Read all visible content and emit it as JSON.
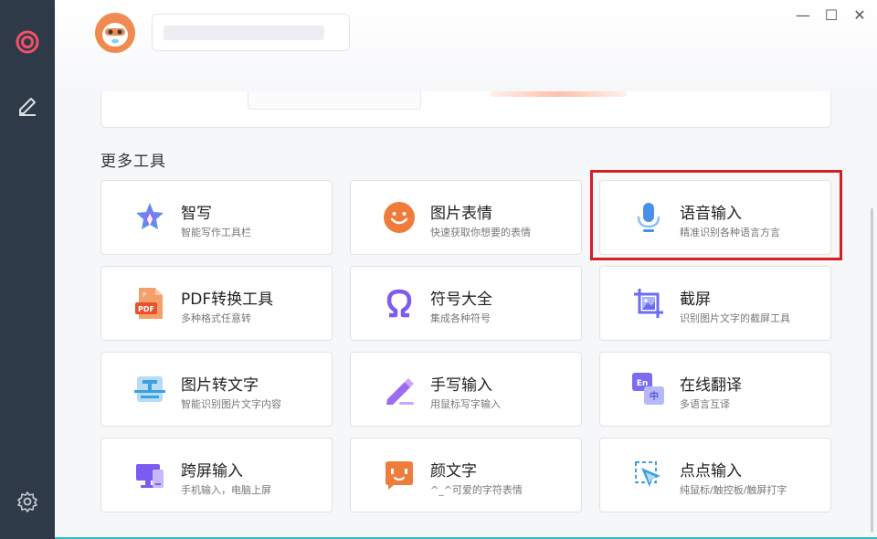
{
  "sidebar": {
    "items": [
      {
        "name": "target-icon"
      },
      {
        "name": "edit-icon"
      },
      {
        "name": "settings-icon"
      }
    ]
  },
  "window": {
    "minimize": "—",
    "maximize": "☐",
    "close": "✕"
  },
  "section_title": "更多工具",
  "tools": [
    {
      "title": "智写",
      "sub": "智能写作工具栏",
      "icon": "star-pen-icon"
    },
    {
      "title": "图片表情",
      "sub": "快速获取你想要的表情",
      "icon": "smiley-icon"
    },
    {
      "title": "语音输入",
      "sub": "精准识别各种语言方言",
      "icon": "microphone-icon"
    },
    {
      "title": "PDF转换工具",
      "sub": "多种格式任意转",
      "icon": "pdf-icon"
    },
    {
      "title": "符号大全",
      "sub": "集成各种符号",
      "icon": "omega-icon"
    },
    {
      "title": "截屏",
      "sub": "识别图片文字的截屏工具",
      "icon": "screenshot-icon"
    },
    {
      "title": "图片转文字",
      "sub": "智能识别图片文字内容",
      "icon": "ocr-icon"
    },
    {
      "title": "手写输入",
      "sub": "用鼠标写字输入",
      "icon": "pencil-icon"
    },
    {
      "title": "在线翻译",
      "sub": "多语言互译",
      "icon": "translate-icon",
      "badge_en": "En",
      "badge_zh": "中"
    },
    {
      "title": "跨屏输入",
      "sub": "手机输入，电脑上屏",
      "icon": "cross-screen-icon"
    },
    {
      "title": "颜文字",
      "sub": "^_^可爱的字符表情",
      "icon": "kaomoji-icon"
    },
    {
      "title": "点点输入",
      "sub": "纯鼠标/触控板/触屏打字",
      "icon": "cursor-click-icon"
    }
  ],
  "colors": {
    "sidebar": "#2e3a48",
    "highlight": "#d21f1f",
    "accent_blue": "#4a8fe8",
    "accent_orange": "#f07c3c"
  }
}
